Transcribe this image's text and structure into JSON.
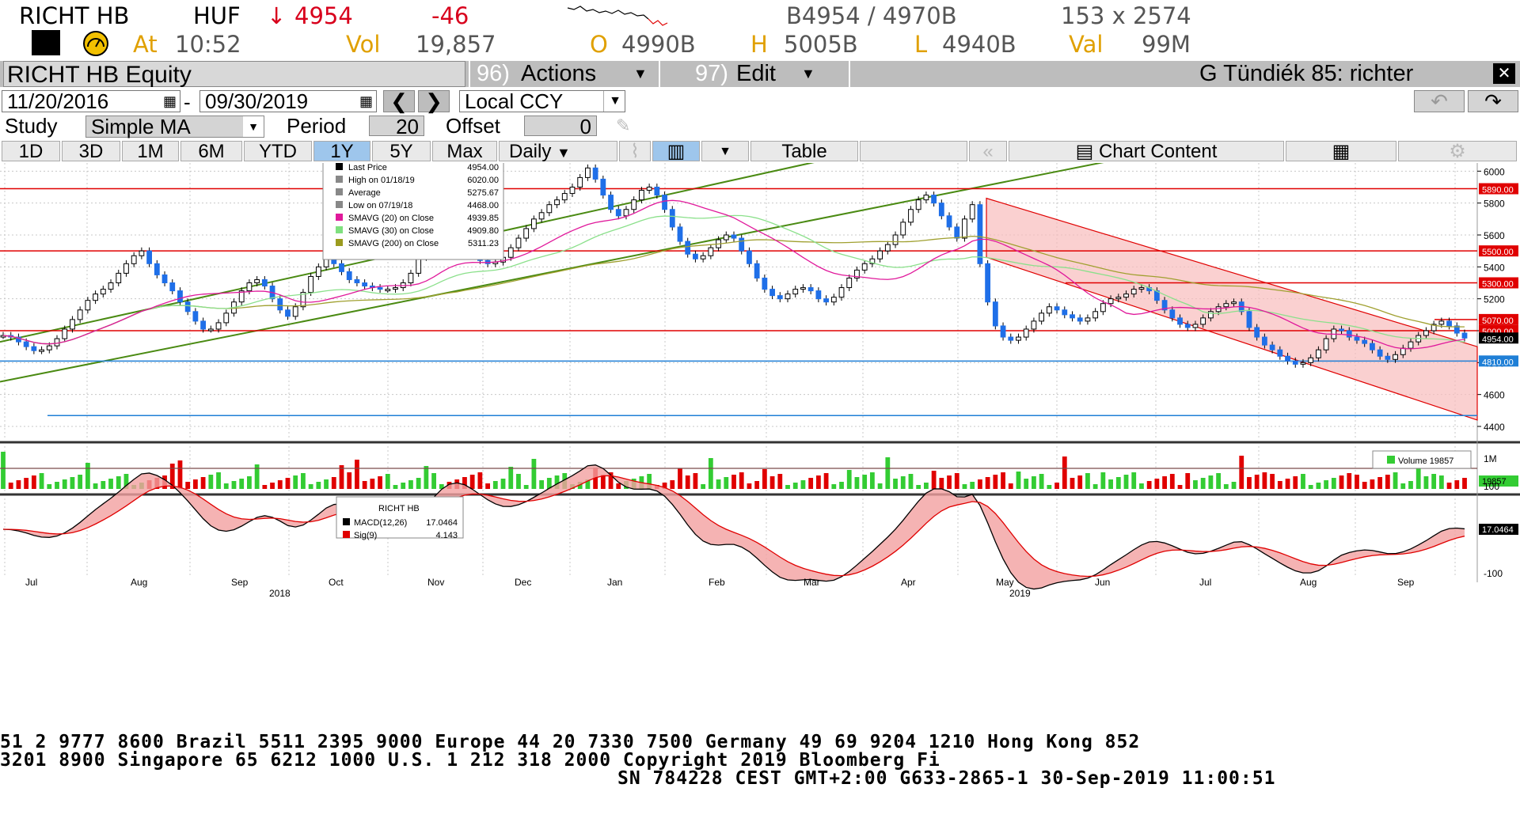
{
  "quote": {
    "ticker": "RICHT HB",
    "currency": "HUF",
    "last_arrow": "↓",
    "last": "4954",
    "change": "-46",
    "bid_ask": "B4954 / 4970B",
    "size": "153 x 2574",
    "at_label": "At",
    "time": "10:52",
    "vol_label": "Vol",
    "vol": "19,857",
    "open_label": "O",
    "open": "4990B",
    "high_label": "H",
    "high": "5005B",
    "low_label": "L",
    "low": "4940B",
    "val_label": "Val",
    "val": "99M"
  },
  "titlebar": {
    "security": "RICHT HB Equity",
    "actions_num": "96)",
    "actions": "Actions",
    "edit_num": "97)",
    "edit": "Edit",
    "right_title": "G Tündiék 85: richter"
  },
  "controls": {
    "start_date": "11/20/2016",
    "date_dash": "-",
    "end_date": "09/30/2019",
    "currency": "Local CCY",
    "study_label": "Study",
    "study": "Simple MA",
    "period_label": "Period",
    "period": "20",
    "offset_label": "Offset",
    "offset": "0"
  },
  "toolbar": {
    "ranges": [
      "1D",
      "3D",
      "1M",
      "6M",
      "YTD",
      "1Y",
      "5Y",
      "Max"
    ],
    "selected_range": "1Y",
    "frequency": "Daily",
    "table": "Table",
    "chart_content": "Chart Content"
  },
  "legend": {
    "rows": [
      {
        "label": "Last Price",
        "value": "4954.00",
        "color": "#000000"
      },
      {
        "label": "High on 01/18/19",
        "value": "6020.00",
        "color": "#888888"
      },
      {
        "label": "Average",
        "value": "5275.67",
        "color": "#888888"
      },
      {
        "label": "Low on 07/19/18",
        "value": "4468.00",
        "color": "#888888"
      },
      {
        "label": "SMAVG (20)  on Close",
        "value": "4939.85",
        "color": "#e0199b"
      },
      {
        "label": "SMAVG (30)  on Close",
        "value": "4909.80",
        "color": "#7fe07f"
      },
      {
        "label": "SMAVG (200)  on Close",
        "value": "5311.23",
        "color": "#9b9b1f"
      }
    ]
  },
  "volume_legend": {
    "label": "Volume",
    "value": "19857"
  },
  "macd_legend": {
    "title": "RICHT HB",
    "rows": [
      {
        "label": "MACD(12,26)",
        "value": "17.0464",
        "color": "#000000"
      },
      {
        "label": "Sig(9)",
        "value": "4.143",
        "color": "#e00000"
      }
    ]
  },
  "chart_data": {
    "type": "candlestick",
    "price_axis_ticks": [
      "6200",
      "6000",
      "5800",
      "5600",
      "5400",
      "5200",
      "5000",
      "4800",
      "4600",
      "4400"
    ],
    "price_ylim": [
      4400,
      6200
    ],
    "price_tags": [
      {
        "value": "5890.00",
        "color": "#e00000"
      },
      {
        "value": "5500.00",
        "color": "#e00000"
      },
      {
        "value": "5300.00",
        "color": "#e00000"
      },
      {
        "value": "5070.00",
        "color": "#e00000"
      },
      {
        "value": "5000.00",
        "color": "#e00000"
      },
      {
        "value": "4954.00",
        "color": "#000000"
      },
      {
        "value": "4810.00",
        "color": "#1f7fd6"
      }
    ],
    "horizontal_levels": [
      5890,
      5500,
      5300,
      5000,
      4810,
      4468
    ],
    "volume_ticks": [
      "1M"
    ],
    "volume_tag": "19857",
    "macd_ticks": [
      "100",
      "-100"
    ],
    "macd_tag": "17.0464",
    "month_labels": [
      "Jul",
      "Aug",
      "Sep",
      "Oct",
      "Nov",
      "Dec",
      "Jan",
      "Feb",
      "Mar",
      "Apr",
      "May",
      "Jun",
      "Jul",
      "Aug",
      "Sep"
    ],
    "year_labels": [
      "2018",
      "2019"
    ],
    "close_series": [
      4970,
      4960,
      4930,
      4900,
      4875,
      4880,
      4905,
      4950,
      5010,
      5070,
      5130,
      5190,
      5230,
      5260,
      5300,
      5360,
      5420,
      5470,
      5500,
      5420,
      5350,
      5300,
      5250,
      5180,
      5120,
      5060,
      5010,
      5010,
      5050,
      5110,
      5180,
      5250,
      5300,
      5320,
      5280,
      5200,
      5130,
      5090,
      5150,
      5240,
      5340,
      5400,
      5450,
      5420,
      5370,
      5320,
      5300,
      5280,
      5270,
      5260,
      5260,
      5270,
      5300,
      5360,
      5460,
      5560,
      5650,
      5700,
      5680,
      5620,
      5550,
      5480,
      5440,
      5420,
      5430,
      5460,
      5520,
      5580,
      5640,
      5700,
      5740,
      5790,
      5820,
      5860,
      5900,
      5960,
      6020,
      5950,
      5850,
      5760,
      5720,
      5760,
      5820,
      5880,
      5900,
      5850,
      5760,
      5650,
      5560,
      5480,
      5450,
      5470,
      5520,
      5570,
      5600,
      5580,
      5500,
      5420,
      5330,
      5260,
      5220,
      5200,
      5230,
      5260,
      5270,
      5250,
      5200,
      5180,
      5210,
      5270,
      5330,
      5380,
      5420,
      5450,
      5500,
      5540,
      5600,
      5680,
      5760,
      5820,
      5850,
      5800,
      5720,
      5650,
      5580,
      5700,
      5790,
      5420,
      5180,
      5030,
      4960,
      4940,
      4960,
      5010,
      5060,
      5110,
      5150,
      5130,
      5100,
      5080,
      5060,
      5080,
      5120,
      5170,
      5200,
      5210,
      5230,
      5260,
      5270,
      5250,
      5190,
      5130,
      5080,
      5040,
      5020,
      5040,
      5080,
      5120,
      5150,
      5170,
      5180,
      5120,
      5020,
      4960,
      4910,
      4880,
      4840,
      4810,
      4790,
      4800,
      4830,
      4880,
      4950,
      5010,
      5000,
      4960,
      4940,
      4920,
      4880,
      4840,
      4820,
      4850,
      4890,
      4930,
      4970,
      5000,
      5040,
      5060,
      5030,
      4985,
      4954
    ]
  },
  "footer": {
    "line1": "51 2 9777 8600 Brazil 5511 2395 9000 Europe 44 20 7330 7500 Germany 49 69 9204 1210 Hong Kong 852",
    "line2": " 3201 8900       Singapore 65 6212 1000       U.S. 1 212 318 2000         Copyright 2019 Bloomberg Fi",
    "line3": "SN 784228 CEST GMT+2:00 G633-2865-1 30-Sep-2019 11:00:51"
  }
}
